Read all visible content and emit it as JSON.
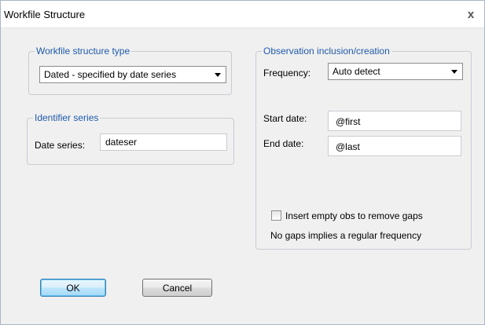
{
  "window": {
    "title": "Workfile Structure",
    "close_glyph": "x"
  },
  "structure_type": {
    "legend": "Workfile structure type",
    "selected": "Dated - specified by date series"
  },
  "identifier": {
    "legend": "Identifier series",
    "date_series_label": "Date series:",
    "date_series_value": "dateser"
  },
  "observation": {
    "legend": "Observation inclusion/creation",
    "frequency_label": "Frequency:",
    "frequency_selected": "Auto detect",
    "start_label": "Start date:",
    "start_value": "@first",
    "end_label": "End date:",
    "end_value": "@last",
    "insert_empty_label": "Insert empty obs to remove gaps",
    "insert_empty_checked": false,
    "note": "No gaps implies a regular frequency"
  },
  "buttons": {
    "ok": "OK",
    "cancel": "Cancel"
  },
  "colors": {
    "legend_text": "#1e5ab0",
    "default_button_border": "#3c7fb1"
  }
}
